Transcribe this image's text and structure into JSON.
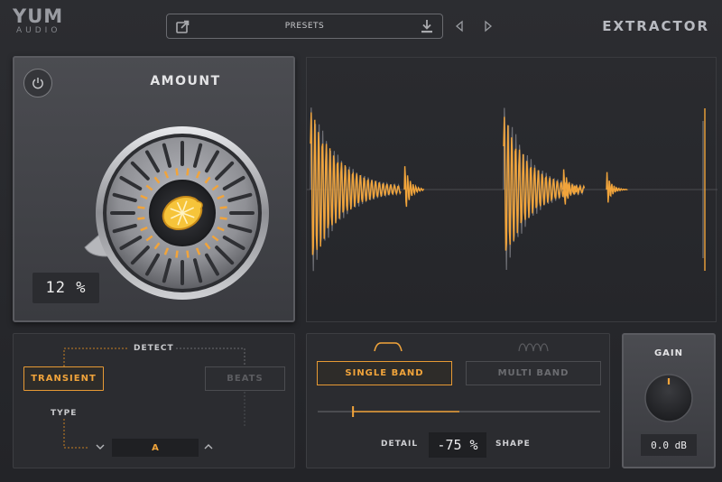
{
  "header": {
    "brand_name": "YUM",
    "brand_sub": "AUDIO",
    "presets_label": "PRESETS",
    "product_name": "EXTRACTOR"
  },
  "amount": {
    "title": "AMOUNT",
    "value_display": "12 %",
    "level_fraction": 0.12
  },
  "detect": {
    "title": "DETECT",
    "transient_label": "TRANSIENT",
    "beats_label": "BEATS",
    "type_label": "TYPE",
    "type_value": "A",
    "selected": "TRANSIENT"
  },
  "band": {
    "single_label": "SINGLE BAND",
    "multi_label": "MULTI BAND",
    "selected": "SINGLE BAND",
    "detail_label": "DETAIL",
    "shape_label": "SHAPE",
    "detail_shape_value": "-75 %",
    "slider_fraction": 0.125
  },
  "gain": {
    "title": "GAIN",
    "value_display": "0.0  dB",
    "level_fraction": 0.5
  },
  "colors": {
    "accent": "#f1a43b",
    "panel": "#2b2c30",
    "waveform_grey": "#6f7076"
  },
  "icons": {
    "power": "power-icon",
    "export": "export-icon",
    "save": "download-icon",
    "prev": "triangle-left-icon",
    "next": "triangle-right-icon",
    "lemon": "lemon-icon"
  }
}
